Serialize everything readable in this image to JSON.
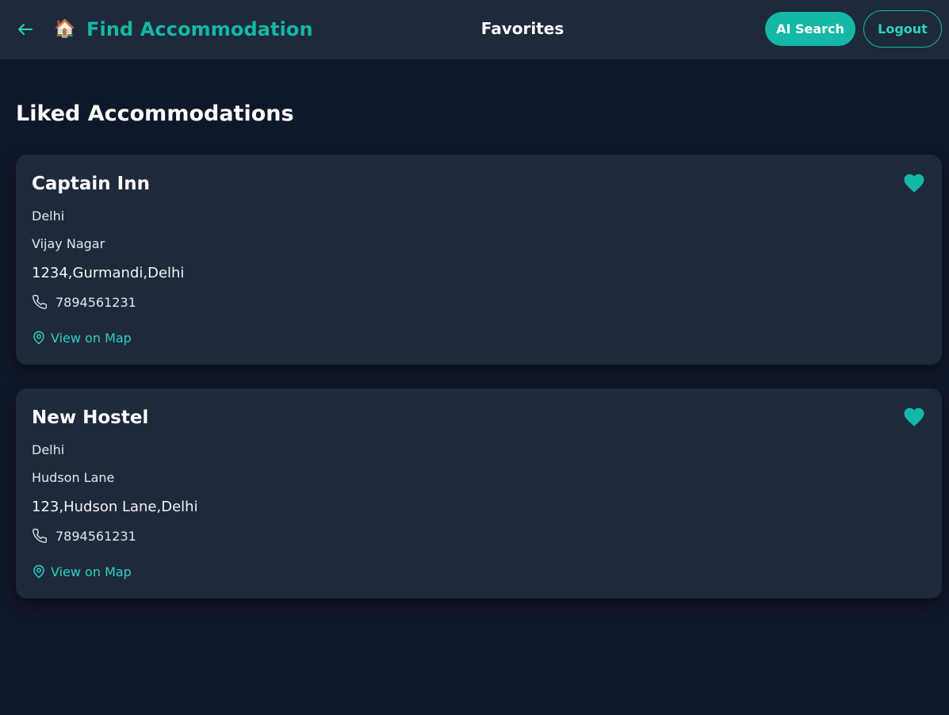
{
  "header": {
    "back_icon": "arrow-left-icon",
    "brand_icon": "house-icon",
    "brand_emoji": "🏠",
    "brand_title": "Find Accommodation",
    "page_title": "Favorites",
    "ai_search_label": "AI Search",
    "logout_label": "Logout"
  },
  "main": {
    "heading": "Liked Accommodations",
    "cards": [
      {
        "name": "Captain Inn",
        "city": "Delhi",
        "area": "Vijay Nagar",
        "address": "1234,Gurmandi,Delhi",
        "phone": "7894561231",
        "map_label": "View on Map",
        "liked": true
      },
      {
        "name": "New Hostel",
        "city": "Delhi",
        "area": "Hudson Lane",
        "address": "123,Hudson Lane,Delhi",
        "phone": "7894561231",
        "map_label": "View on Map",
        "liked": true
      }
    ]
  },
  "colors": {
    "background": "#0f172a",
    "surface": "#1e293b",
    "accent": "#14b8a6",
    "accent_light": "#2dd4bf"
  }
}
